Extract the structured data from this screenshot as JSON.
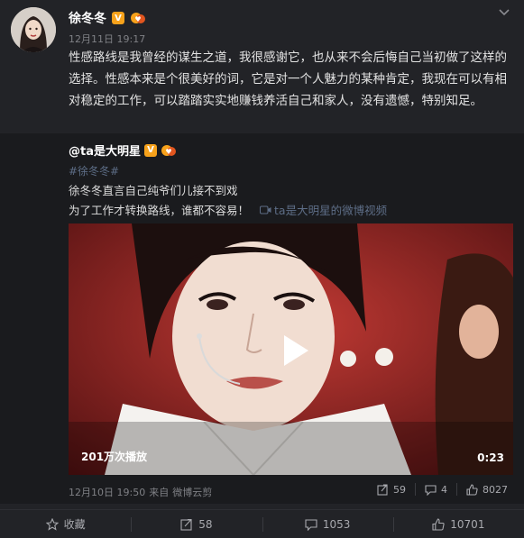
{
  "post": {
    "author": "徐冬冬",
    "verified_badge": "V",
    "time": "12月11日 19:17",
    "text": "性感路线是我曾经的谋生之道，我很感谢它，也从来不会后悔自己当初做了这样的选择。性感本来是个很美好的词，它是对一个人魅力的某种肯定，我现在可以有相对稳定的工作，可以踏踏实实地赚钱养活自己和家人，没有遗憾，特别知足。"
  },
  "repost": {
    "author": "@ta是大明星",
    "verified_badge": "V",
    "hashtag": "#徐冬冬#",
    "line1": "徐冬冬直言自己纯爷们儿接不到戏",
    "line2": "为了工作才转换路线，谁都不容易！",
    "video_link": "ta是大明星的微博视频",
    "video": {
      "views": "201万次播放",
      "duration": "0:23"
    },
    "time": "12月10日 19:50",
    "source_prefix": "来自",
    "source": "微博云剪",
    "actions": {
      "repost_count": "59",
      "comment_count": "4",
      "like_count": "8027"
    }
  },
  "bottom_bar": {
    "favorite_label": "收藏",
    "repost_count": "58",
    "comment_count": "1053",
    "like_count": "10701"
  },
  "colors": {
    "background": "#222327",
    "repost_background": "#1a1b1e",
    "link": "#5d6d86",
    "badge": "#f7a21b"
  }
}
